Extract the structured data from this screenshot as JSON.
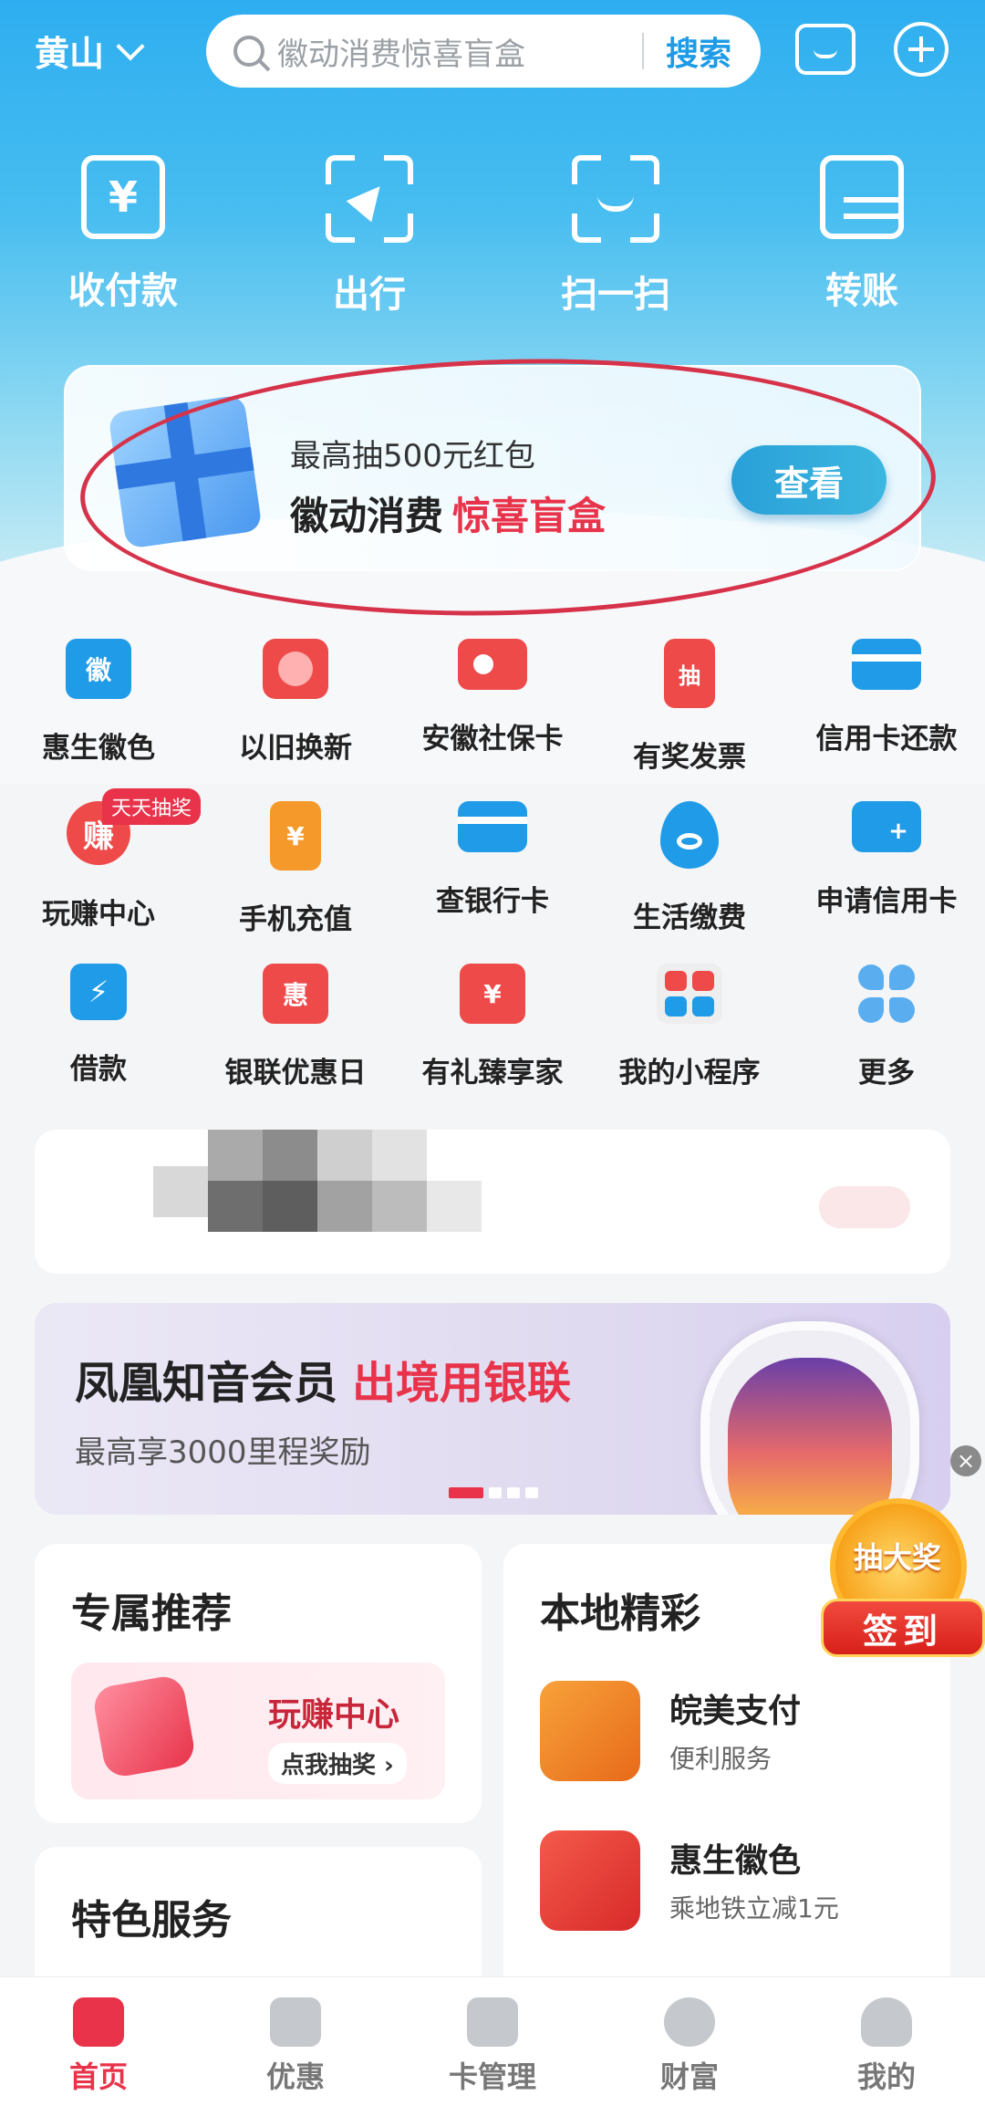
{
  "header": {
    "city": "黄山",
    "search_placeholder": "徽动消费惊喜盲盒",
    "search_button": "搜索"
  },
  "quick_actions": [
    {
      "label": "收付款",
      "icon": "pay-icon"
    },
    {
      "label": "出行",
      "icon": "travel-icon"
    },
    {
      "label": "扫一扫",
      "icon": "scan-icon"
    },
    {
      "label": "转账",
      "icon": "transfer-icon"
    }
  ],
  "banner": {
    "subtitle": "最高抽500元红包",
    "title": "徽动消费",
    "title_highlight": "惊喜盲盒",
    "button": "查看"
  },
  "services": [
    [
      {
        "label": "惠生徽色",
        "icon_text": "徽",
        "color": "#1f9be8"
      },
      {
        "label": "以旧换新",
        "icon_text": "",
        "color": "#ee4a4a"
      },
      {
        "label": "安徽社保卡",
        "icon_text": "",
        "color": "#ee4a4a"
      },
      {
        "label": "有奖发票",
        "icon_text": "抽",
        "color": "#ee4a4a"
      },
      {
        "label": "信用卡还款",
        "icon_text": "",
        "color": "#1f9be8"
      }
    ],
    [
      {
        "label": "玩赚中心",
        "icon_text": "赚",
        "color": "#ee4a4a",
        "badge": "天天抽奖"
      },
      {
        "label": "手机充值",
        "icon_text": "¥",
        "color": "#f59a2a"
      },
      {
        "label": "查银行卡",
        "icon_text": "",
        "color": "#1f9be8"
      },
      {
        "label": "生活缴费",
        "icon_text": "",
        "color": "#1f9be8"
      },
      {
        "label": "申请信用卡",
        "icon_text": "",
        "color": "#1f9be8"
      }
    ],
    [
      {
        "label": "借款",
        "icon_text": "⚡",
        "color": "#1f9be8"
      },
      {
        "label": "银联优惠日",
        "icon_text": "惠",
        "color": "#ee4a4a"
      },
      {
        "label": "有礼臻享家",
        "icon_text": "¥",
        "color": "#ee4a4a"
      },
      {
        "label": "我的小程序",
        "icon_text": "",
        "color": "#eeeeee"
      },
      {
        "label": "更多",
        "icon_text": "",
        "color": "#5aaef0"
      }
    ]
  ],
  "promo": {
    "title": "凤凰知音会员",
    "title_highlight": "出境用银联",
    "subtitle": "最高享3000里程奖励"
  },
  "lottery": {
    "top": "抽大奖",
    "button": "签到"
  },
  "recommend": {
    "title": "专属推荐",
    "item_title": "玩赚中心",
    "item_button": "点我抽奖 ›"
  },
  "local": {
    "title": "本地精彩",
    "items": [
      {
        "name": "皖美支付",
        "desc": "便利服务"
      },
      {
        "name": "惠生徽色",
        "desc": "乘地铁立减1元"
      }
    ]
  },
  "featured": {
    "title": "特色服务"
  },
  "tabs": [
    {
      "label": "首页",
      "active": true
    },
    {
      "label": "优惠",
      "active": false
    },
    {
      "label": "卡管理",
      "active": false
    },
    {
      "label": "财富",
      "active": false
    },
    {
      "label": "我的",
      "active": false
    }
  ],
  "colors": {
    "accent_red": "#e8334a",
    "brand_blue": "#1e9be6"
  }
}
